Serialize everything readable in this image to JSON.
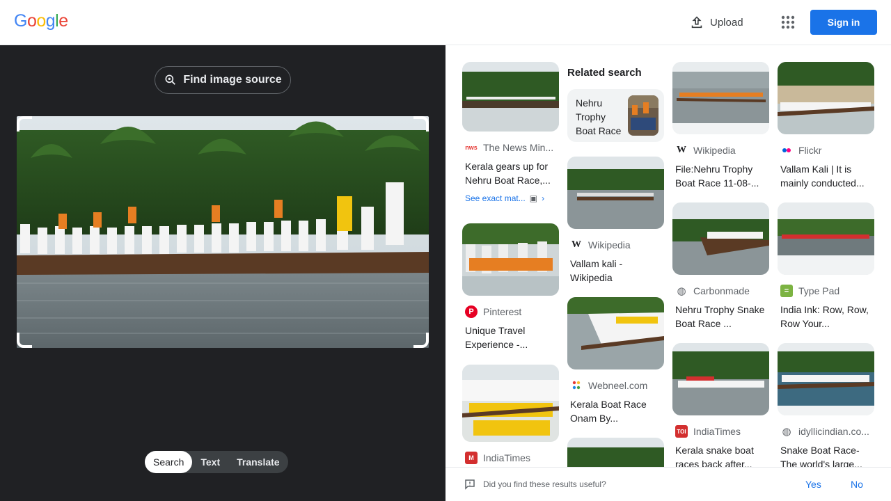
{
  "logo": {
    "letters": [
      "G",
      "o",
      "o",
      "g",
      "l",
      "e"
    ],
    "colors": [
      "#4285f4",
      "#ea4335",
      "#fbbc05",
      "#4285f4",
      "#34a853",
      "#ea4335"
    ]
  },
  "header": {
    "upload_label": "Upload",
    "signin_label": "Sign in",
    "apps_icon": "apps-grid-icon"
  },
  "left": {
    "find_source_label": "Find image source",
    "tabs": [
      {
        "label": "Search",
        "active": true
      },
      {
        "label": "Text",
        "active": false
      },
      {
        "label": "Translate",
        "active": false
      }
    ]
  },
  "related": {
    "heading": "Related search",
    "chip_text": "Nehru Trophy Boat Race"
  },
  "results": [
    {
      "source": "The News Min...",
      "title": "Kerala gears up for Nehru Boat Race,...",
      "exact_match": "See exact mat...",
      "favicon": "newsminute-icon"
    },
    {
      "source": "Pinterest",
      "title": "Unique Travel Experience -...",
      "favicon": "pinterest-icon"
    },
    {
      "source": "IndiaTimes",
      "title": "",
      "favicon": "indiatimes-icon"
    },
    {
      "source": "Wikipedia",
      "title": "Vallam kali - Wikipedia",
      "favicon": "wikipedia-icon"
    },
    {
      "source": "Webneel.com",
      "title": "Kerala Boat Race Onam By...",
      "favicon": "webneel-icon"
    },
    {
      "source": "Wikipedia",
      "title": "File:Nehru Trophy Boat Race 11-08-...",
      "favicon": "wikipedia-icon"
    },
    {
      "source": "Carbonmade",
      "title": "Nehru Trophy Snake Boat Race ...",
      "favicon": "globe-icon"
    },
    {
      "source": "IndiaTimes",
      "title": "Kerala snake boat races back after...",
      "favicon": "indiatimes-icon"
    },
    {
      "source": "Flickr",
      "title": "Vallam Kali | It is mainly conducted...",
      "favicon": "flickr-icon"
    },
    {
      "source": "Type Pad",
      "title": "India Ink: Row, Row, Row Your...",
      "favicon": "typepad-icon"
    },
    {
      "source": "idyllicindian.co...",
      "title": "Snake Boat Race- The world's large...",
      "favicon": "globe-icon"
    }
  ],
  "feedback": {
    "question": "Did you find these results useful?",
    "yes": "Yes",
    "no": "No"
  }
}
